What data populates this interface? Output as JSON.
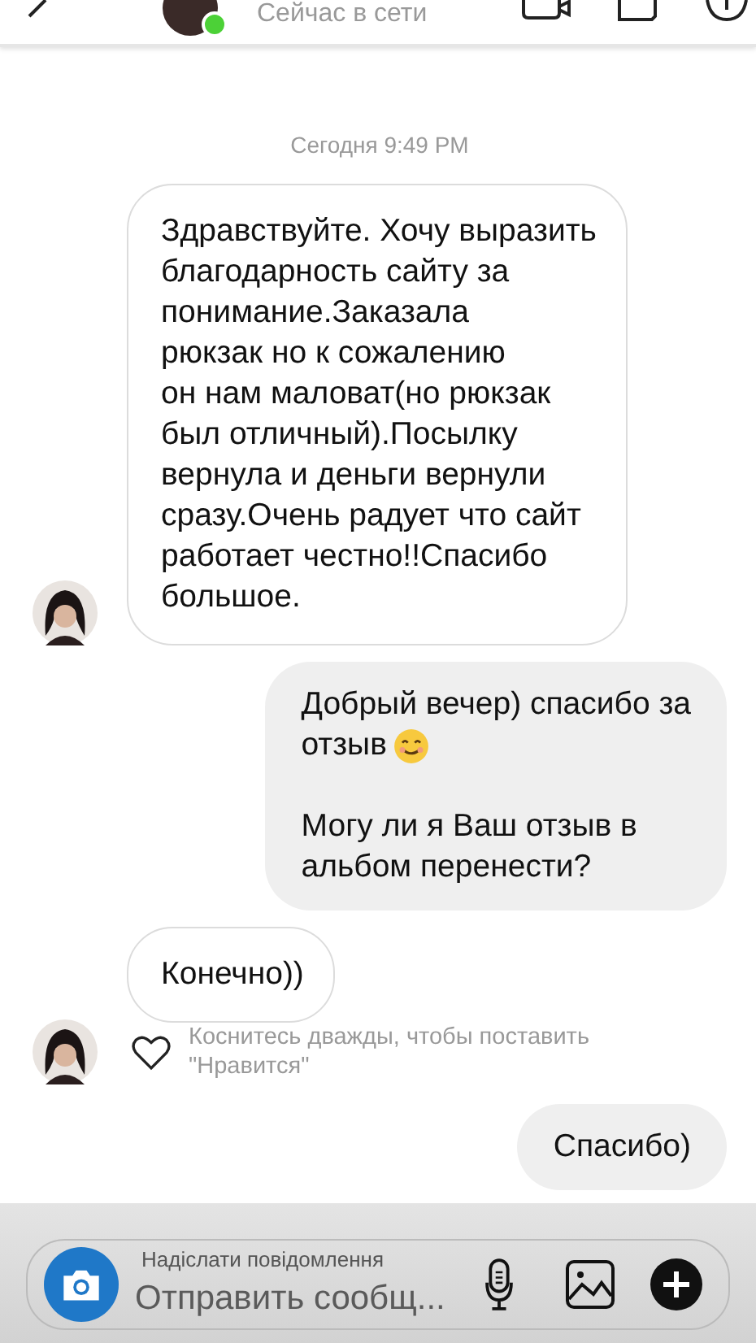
{
  "header": {
    "status": "Сейчас в сети",
    "online": true
  },
  "date": "Сегодня 9:49 PM",
  "messages": [
    {
      "kind": "incoming",
      "text": "Здравствуйте. Хочу выразить\nблагодарность сайту за\nпонимание.Заказала\nрюкзак но к сожалению\nон нам маловат(но рюкзак\nбыл отличный).Посылку\nвернула и деньги вернули\nсразу.Очень радует что сайт\nработает честно!!Спасибо\nбольшое.",
      "avatar": true
    },
    {
      "kind": "outgoing",
      "paragraphs": [
        [
          "Добрый вечер) спасибо за",
          "отзыв"
        ],
        [
          "Могу ли я Ваш отзыв в",
          "альбом перенести?"
        ]
      ],
      "emoji": true
    },
    {
      "kind": "incoming",
      "text": "Конечно))",
      "avatar": false
    },
    {
      "kind": "like_hint",
      "text": "Коснитесь дважды, чтобы поставить\n\"Нравится\"",
      "avatar": true
    },
    {
      "kind": "outgoing",
      "paragraphs": [
        [
          "Спасибо)"
        ]
      ],
      "emoji": false
    }
  ],
  "composer": {
    "placeholder": "Отправить сообщ...",
    "overlay_text": "Надіслати повідомлення"
  }
}
